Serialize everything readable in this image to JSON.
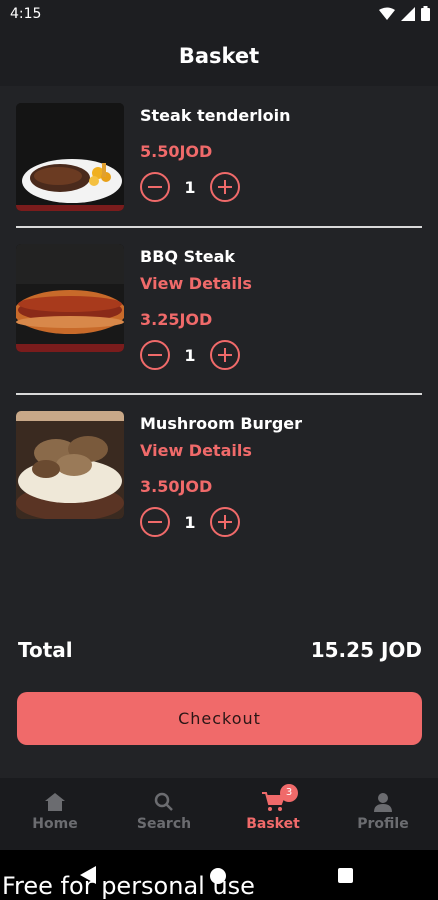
{
  "status_bar": {
    "time": "4:15"
  },
  "header": {
    "title": "Basket"
  },
  "items": [
    {
      "name": "Steak tenderloin",
      "link": "",
      "price": "5.50JOD",
      "qty": "1",
      "image": "steak-plate"
    },
    {
      "name": "BBQ Steak",
      "link": "View Details",
      "price": "3.25JOD",
      "qty": "1",
      "image": "bbq-steak-sandwich"
    },
    {
      "name": "Mushroom Burger",
      "link": "View Details",
      "price": "3.50JOD",
      "qty": "1",
      "image": "mushroom-burger"
    }
  ],
  "summary": {
    "total_label": "Total",
    "total_value": "15.25 JOD"
  },
  "checkout_label": "Checkout",
  "nav": {
    "home": "Home",
    "search": "Search",
    "basket": "Basket",
    "basket_badge": "3",
    "profile": "Profile"
  },
  "watermark": "Free for personal use",
  "colors": {
    "accent": "#f06a6a",
    "background": "#222326",
    "nav_background": "#1a1b1e"
  }
}
